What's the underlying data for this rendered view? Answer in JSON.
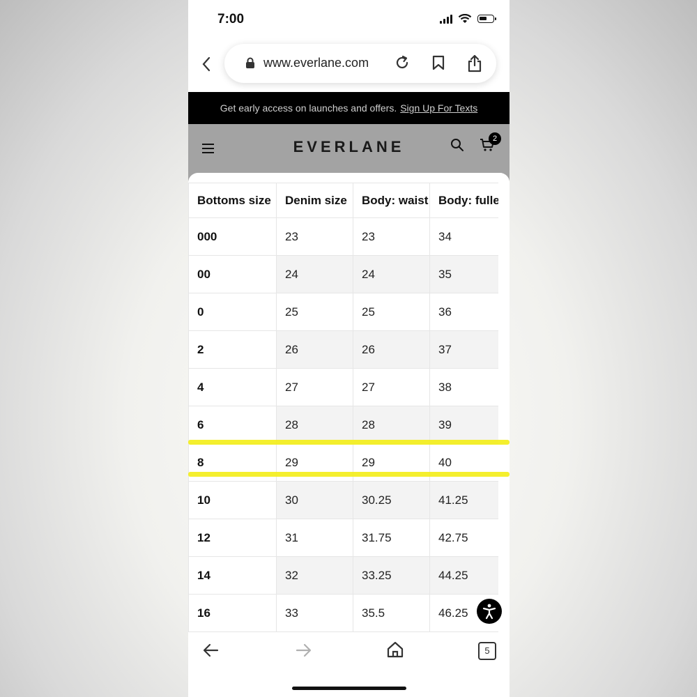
{
  "status_bar": {
    "time": "7:00"
  },
  "browser": {
    "url": "www.everlane.com",
    "tab_count": "5"
  },
  "promo": {
    "text": "Get early access on launches and offers.",
    "link": "Sign Up For Texts"
  },
  "header": {
    "logo": "EVERLANE",
    "cart_count": "2"
  },
  "size_table": {
    "headers": [
      "Bottoms size",
      "Denim size",
      "Body: waist",
      "Body: fulles"
    ],
    "rows": [
      [
        "000",
        "23",
        "23",
        "34"
      ],
      [
        "00",
        "24",
        "24",
        "35"
      ],
      [
        "0",
        "25",
        "25",
        "36"
      ],
      [
        "2",
        "26",
        "26",
        "37"
      ],
      [
        "4",
        "27",
        "27",
        "38"
      ],
      [
        "6",
        "28",
        "28",
        "39"
      ],
      [
        "8",
        "29",
        "29",
        "40"
      ],
      [
        "10",
        "30",
        "30.25",
        "41.25"
      ],
      [
        "12",
        "31",
        "31.75",
        "42.75"
      ],
      [
        "14",
        "32",
        "33.25",
        "44.25"
      ],
      [
        "16",
        "33",
        "35.5",
        "46.25"
      ]
    ]
  },
  "highlight_color": "#f3ee1c"
}
